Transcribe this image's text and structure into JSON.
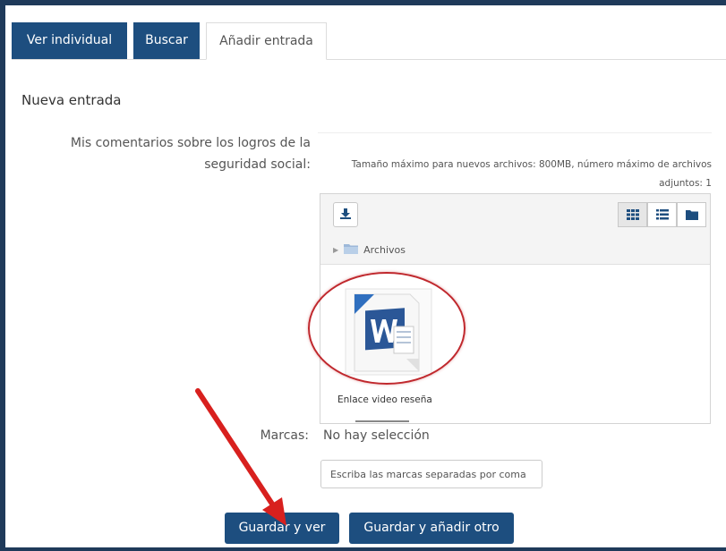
{
  "tabs": [
    {
      "label": "Ver individual",
      "active": false
    },
    {
      "label": "Buscar",
      "active": false
    },
    {
      "label": "Añadir entrada",
      "active": true
    }
  ],
  "section_title": "Nueva entrada",
  "comments_field": {
    "label": "Mis comentarios sobre los logros de la seguridad social:",
    "limits_text": "Tamaño máximo para nuevos archivos: 800MB, número máximo de archivos adjuntos: 1"
  },
  "file_picker": {
    "icons": {
      "download": "download-icon",
      "grid": "grid-view-icon",
      "list": "list-view-icon",
      "tree": "folder-view-icon"
    },
    "breadcrumb": "Archivos",
    "file": {
      "name": "Enlace video reseña",
      "name_cut": "obliterated-line",
      "type_icon": "word-document-icon"
    }
  },
  "tags": {
    "label": "Marcas:",
    "value": "No hay selección",
    "input_placeholder": "Escriba las marcas separadas por coma"
  },
  "buttons": {
    "save_view": "Guardar y ver",
    "save_add": "Guardar y añadir otro"
  },
  "colors": {
    "primary": "#1d4e7f",
    "annotation": "#d8201e"
  }
}
